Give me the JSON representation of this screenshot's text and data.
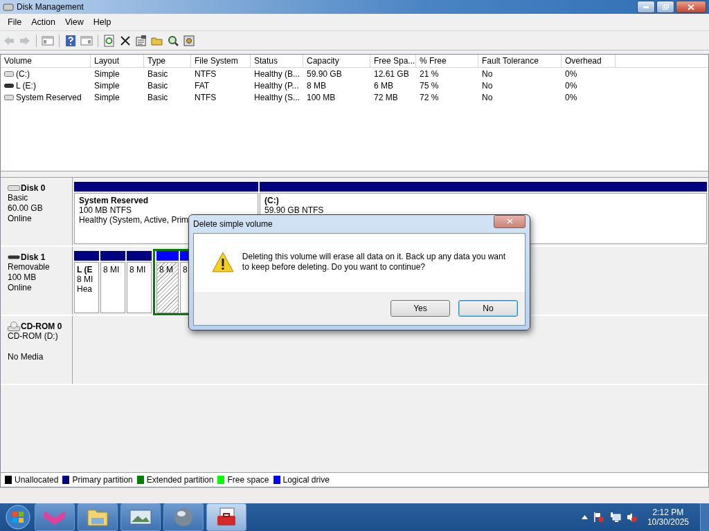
{
  "window": {
    "title": "Disk Management"
  },
  "menu": [
    "File",
    "Action",
    "View",
    "Help"
  ],
  "toolbar": [
    {
      "kind": "back",
      "disabled": true
    },
    {
      "kind": "forward",
      "disabled": true
    },
    {
      "kind": "sep"
    },
    {
      "kind": "tree"
    },
    {
      "kind": "sep"
    },
    {
      "kind": "help"
    },
    {
      "kind": "pane"
    },
    {
      "kind": "sep"
    },
    {
      "kind": "refresh"
    },
    {
      "kind": "delete"
    },
    {
      "kind": "properties"
    },
    {
      "kind": "open"
    },
    {
      "kind": "search"
    },
    {
      "kind": "settings"
    }
  ],
  "table": {
    "columns": [
      "Volume",
      "Layout",
      "Type",
      "File System",
      "Status",
      "Capacity",
      "Free Spa...",
      "% Free",
      "Fault Tolerance",
      "Overhead"
    ],
    "rows": [
      {
        "kind": "fixed",
        "cells": [
          "(C:)",
          "Simple",
          "Basic",
          "NTFS",
          "Healthy (B...",
          "59.90 GB",
          "12.61 GB",
          "21 %",
          "No",
          "0%"
        ]
      },
      {
        "kind": "removable",
        "cells": [
          "L (E:)",
          "Simple",
          "Basic",
          "FAT",
          "Healthy (P...",
          "8 MB",
          "6 MB",
          "75 %",
          "No",
          "0%"
        ]
      },
      {
        "kind": "fixed",
        "cells": [
          "System Reserved",
          "Simple",
          "Basic",
          "NTFS",
          "Healthy (S...",
          "100 MB",
          "72 MB",
          "72 %",
          "No",
          "0%"
        ]
      }
    ]
  },
  "disks": [
    {
      "kind": "basic",
      "name": "Disk 0",
      "lines": [
        "Basic",
        "60.00 GB",
        "Online"
      ],
      "partitions": [
        {
          "kind": "primary",
          "selected": false,
          "title": "System Reserved",
          "lines": [
            "100 MB NTFS",
            "Healthy (System, Active, Prim"
          ]
        },
        {
          "kind": "primary",
          "selected": false,
          "title": "(C:)",
          "lines": [
            "59.90 GB NTFS"
          ]
        }
      ]
    },
    {
      "kind": "removable",
      "name": "Disk 1",
      "lines": [
        "Removable",
        "100 MB",
        "Online"
      ],
      "partitions": [
        {
          "kind": "primary",
          "selected": false,
          "title": "L  (E",
          "lines": [
            "8 MI",
            "Hea"
          ]
        },
        {
          "kind": "primary",
          "selected": false,
          "lines": [
            "8 MI"
          ]
        },
        {
          "kind": "primary",
          "selected": false,
          "lines": [
            "8 MI"
          ]
        },
        {
          "kind": "extended",
          "children": [
            {
              "kind": "logical",
              "selected": true,
              "lines": [
                "8 M"
              ]
            },
            {
              "kind": "logical",
              "selected": false,
              "lines": [
                "8"
              ]
            }
          ]
        }
      ]
    },
    {
      "kind": "cdrom",
      "name": "CD-ROM 0",
      "lines": [
        "CD-ROM (D:)",
        "No Media"
      ]
    }
  ],
  "legend": [
    {
      "label": "Unallocated",
      "color": "#000000"
    },
    {
      "label": "Primary partition",
      "color": "#000080"
    },
    {
      "label": "Extended partition",
      "color": "#008000"
    },
    {
      "label": "Free space",
      "color": "#00ff00"
    },
    {
      "label": "Logical drive",
      "color": "#0000ff"
    }
  ],
  "dialog": {
    "title": "Delete simple volume",
    "message": "Deleting this volume will erase all data on it. Back up any data you want to keep before deleting. Do you want to continue?",
    "buttons": [
      {
        "label": "Yes",
        "focused": false
      },
      {
        "label": "No",
        "focused": true
      }
    ]
  },
  "taskbar": {
    "apps": [
      {
        "kind": "pink",
        "active": false
      },
      {
        "kind": "folder",
        "active": false
      },
      {
        "kind": "photo",
        "active": false
      },
      {
        "kind": "globe",
        "active": false
      },
      {
        "kind": "toolbox",
        "active": true
      }
    ],
    "tray": [
      {
        "kind": "arrow"
      },
      {
        "kind": "flag"
      },
      {
        "kind": "network"
      },
      {
        "kind": "speaker"
      }
    ],
    "time": "2:12 PM",
    "date": "10/30/2025"
  }
}
